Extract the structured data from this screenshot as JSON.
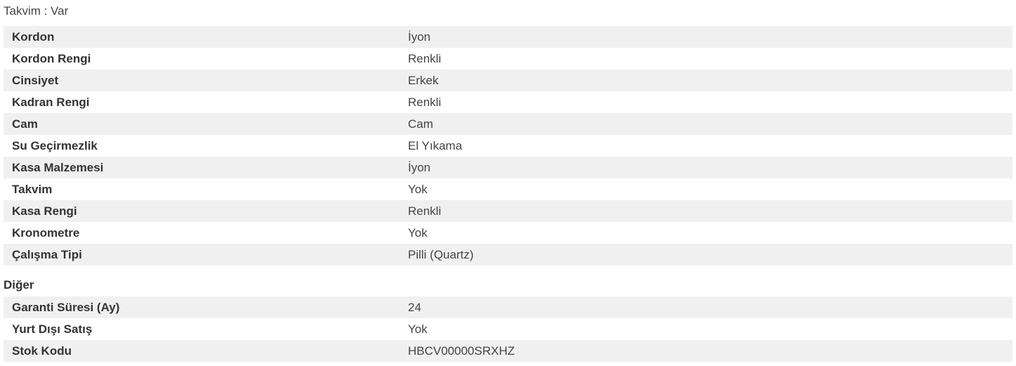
{
  "top_line": "Takvim : Var",
  "specs": [
    {
      "label": "Kordon",
      "value": "İyon"
    },
    {
      "label": "Kordon Rengi",
      "value": "Renkli"
    },
    {
      "label": "Cinsiyet",
      "value": "Erkek"
    },
    {
      "label": "Kadran Rengi",
      "value": "Renkli"
    },
    {
      "label": "Cam",
      "value": "Cam"
    },
    {
      "label": "Su Geçirmezlik",
      "value": "El Yıkama"
    },
    {
      "label": "Kasa Malzemesi",
      "value": "İyon"
    },
    {
      "label": "Takvim",
      "value": "Yok"
    },
    {
      "label": "Kasa Rengi",
      "value": "Renkli"
    },
    {
      "label": "Kronometre",
      "value": "Yok"
    },
    {
      "label": "Çalışma Tipi",
      "value": "Pilli (Quartz)"
    }
  ],
  "other_section": {
    "title": "Diğer",
    "rows": [
      {
        "label": "Garanti Süresi (Ay)",
        "value": "24"
      },
      {
        "label": "Yurt Dışı Satış",
        "value": "Yok"
      },
      {
        "label": "Stok Kodu",
        "value": "HBCV00000SRXHZ"
      }
    ]
  }
}
